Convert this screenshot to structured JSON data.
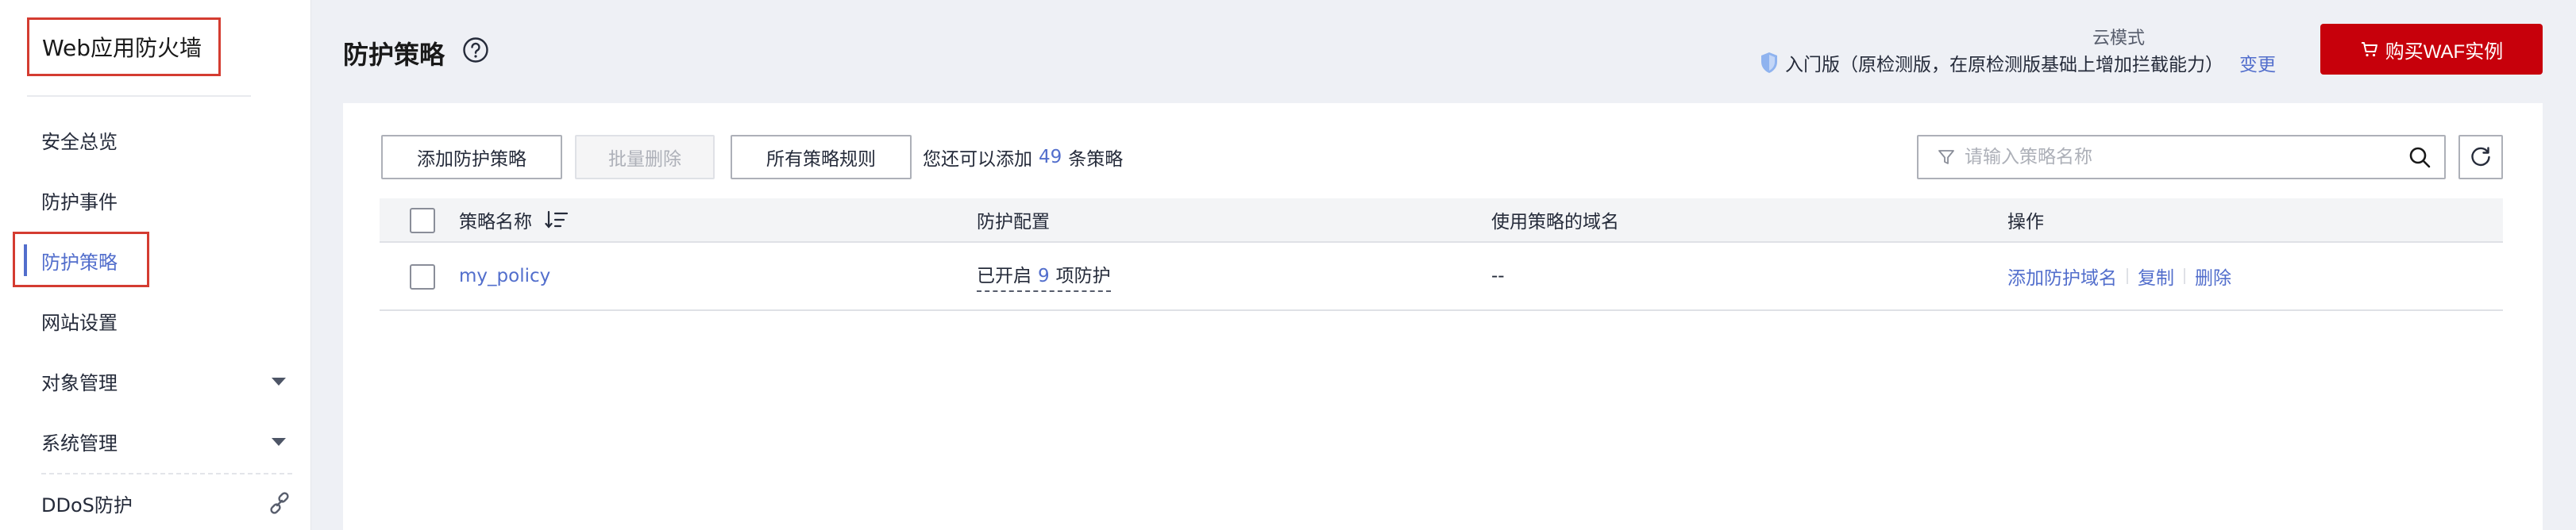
{
  "sidebar": {
    "brand": "Web应用防火墙",
    "items": [
      {
        "label": "安全总览"
      },
      {
        "label": "防护事件"
      },
      {
        "label": "防护策略"
      },
      {
        "label": "网站设置"
      },
      {
        "label": "对象管理"
      },
      {
        "label": "系统管理"
      },
      {
        "label": "DDoS防护"
      }
    ],
    "active_index": 2
  },
  "header": {
    "title": "防护策略",
    "mode": "云模式",
    "edition": "入门版（原检测版，在原检测版基础上增加拦截能力）",
    "change_link": "变更",
    "buy_button": "购买WAF实例"
  },
  "toolbar": {
    "add_policy": "添加防护策略",
    "batch_delete": "批量删除",
    "all_rules": "所有策略规则",
    "quota_prefix": "您还可以添加",
    "quota_value": "49",
    "quota_suffix": "条策略",
    "search_placeholder": "请输入策略名称"
  },
  "table": {
    "columns": [
      "策略名称",
      "防护配置",
      "使用策略的域名",
      "操作"
    ],
    "rows": [
      {
        "name": "my_policy",
        "config_prefix": "已开启",
        "config_count": "9",
        "config_suffix": "项防护",
        "domains": "--",
        "actions": [
          "添加防护域名",
          "复制",
          "删除"
        ]
      }
    ]
  },
  "colors": {
    "accent": "#526ecc",
    "danger": "#c7000b",
    "highlight_box": "#d43c31"
  },
  "icons": [
    "help-icon",
    "shield-icon",
    "cart-icon",
    "filter-icon",
    "search-icon",
    "refresh-icon",
    "sort-icon",
    "chevron-down-icon",
    "link-icon"
  ]
}
